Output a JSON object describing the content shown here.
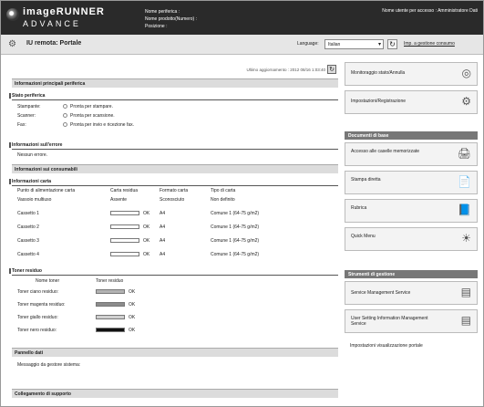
{
  "header": {
    "product_name": "imageRUNNER",
    "product_sub": "ADVANCE",
    "device_info": [
      "Nome periferica :",
      "Nome prodotto(Numero) :",
      "Posizione :"
    ],
    "login": "Nome utente per accesso : Amministratore Dati"
  },
  "subbar": {
    "title": "IU remota: Portale",
    "language_label": "Language:",
    "language_value": "Italian",
    "portal_link": "Imp. a gestione consumo"
  },
  "main": {
    "last_update": "Ultimo aggiornamento : 2012 08/16 1:03:40",
    "sec1_title": "Informazioni principali periferica",
    "status_title": "Stato periferica",
    "status_rows": [
      {
        "label": "Stampante:",
        "value": "Pronta per stampare."
      },
      {
        "label": "Scanner:",
        "value": "Pronta per scansione."
      },
      {
        "label": "Fax:",
        "value": "Pronta per invio e ricezione fax."
      }
    ],
    "error_title": "Informazioni sull'errore",
    "error_value": "Nessun errore.",
    "sec2_title": "Informazioni sui consumabili",
    "paper_title": "Informazioni carta",
    "paper_headers": [
      "Punto di alimentazione carta",
      "Carta residua",
      "Formato carta",
      "Tipo di carta"
    ],
    "paper_rows": [
      {
        "source": "Vassoio multiuso",
        "residual": "Assente",
        "size": "Sconosciuto",
        "type": "Non definito"
      },
      {
        "source": "Cassetto 1",
        "residual": "OK",
        "size": "A4",
        "type": "Comune 1 (64-75 g/m2)"
      },
      {
        "source": "Cassetto 2",
        "residual": "OK",
        "size": "A4",
        "type": "Comune 1 (64-75 g/m2)"
      },
      {
        "source": "Cassetto 3",
        "residual": "OK",
        "size": "A4",
        "type": "Comune 1 (64-75 g/m2)"
      },
      {
        "source": "Cassetto 4",
        "residual": "OK",
        "size": "A4",
        "type": "Comune 1 (64-75 g/m2)"
      }
    ],
    "toner_title": "Toner residuo",
    "toner_headers": [
      "Nome toner",
      "Toner residuo"
    ],
    "toner_rows": [
      {
        "name": "Toner ciano residuo:",
        "status": "OK",
        "color": "#b3b3b3"
      },
      {
        "name": "Toner magenta residuo:",
        "status": "OK",
        "color": "#8c8c8c"
      },
      {
        "name": "Toner giallo residuo:",
        "status": "OK",
        "color": "#d0d0d0"
      },
      {
        "name": "Toner nero residuo:",
        "status": "OK",
        "color": "#111111"
      }
    ],
    "sec3_title": "Pannello dati",
    "sec3_value": "Messaggio da gestore sistema:",
    "sec4_title": "Collegamento di supporto"
  },
  "sidebar": {
    "top_cards": [
      "Monitoraggio stato/Annulla",
      "Impostazioni/Registrazione"
    ],
    "docs_title": "Documenti di base",
    "doc_cards": [
      "Accesso alle caselle memorizzate",
      "Stampa diretta",
      "Rubrica",
      "Quick Menu"
    ],
    "mgmt_title": "Strumenti di gestione",
    "mgmt_cards": [
      "Service Management Service",
      "User Setting Information Management Service"
    ],
    "portal_link": "Impostazioni visualizzazione portale"
  },
  "icons": {
    "logo": "canon-logo-icon",
    "refresh": "refresh-icon",
    "page": "portal-icon"
  }
}
